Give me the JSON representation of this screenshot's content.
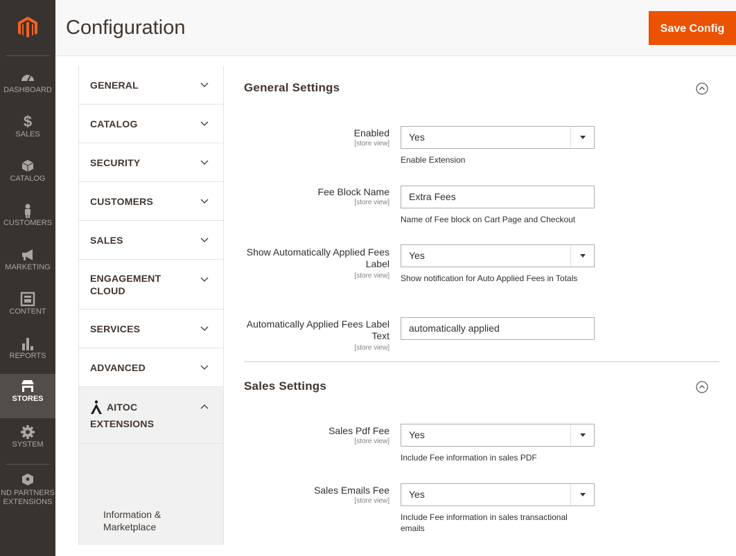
{
  "page": {
    "title": "Configuration",
    "save_label": "Save Config"
  },
  "admin_nav": [
    {
      "label": "DASHBOARD",
      "icon": "dashboard-icon"
    },
    {
      "label": "SALES",
      "icon": "dollar-icon"
    },
    {
      "label": "CATALOG",
      "icon": "cube-icon"
    },
    {
      "label": "CUSTOMERS",
      "icon": "person-icon"
    },
    {
      "label": "MARKETING",
      "icon": "megaphone-icon"
    },
    {
      "label": "CONTENT",
      "icon": "content-icon"
    },
    {
      "label": "REPORTS",
      "icon": "bar-chart-icon"
    },
    {
      "label": "STORES",
      "icon": "store-icon",
      "active": true
    },
    {
      "label": "SYSTEM",
      "icon": "gear-icon"
    },
    {
      "label": "ND PARTNERS",
      "label2": "EXTENSIONS",
      "icon": "extensions-icon"
    }
  ],
  "config_tabs": [
    {
      "label": "GENERAL"
    },
    {
      "label": "CATALOG"
    },
    {
      "label": "SECURITY"
    },
    {
      "label": "CUSTOMERS"
    },
    {
      "label": "SALES"
    },
    {
      "label": "ENGAGEMENT",
      "label2": "CLOUD"
    },
    {
      "label": "SERVICES"
    },
    {
      "label": "ADVANCED"
    },
    {
      "label": "AITOC",
      "label2": "EXTENSIONS",
      "expanded": true
    }
  ],
  "aitoc_item": "Information & Marketplace",
  "sections": {
    "general": {
      "title": "General Settings",
      "fields": [
        {
          "label": "Enabled",
          "scope": "[store view]",
          "value": "Yes",
          "note": "Enable Extension",
          "type": "select"
        },
        {
          "label": "Fee Block Name",
          "scope": "[store view]",
          "value": "Extra Fees",
          "note": "Name of Fee block on Cart Page and Checkout",
          "type": "text"
        },
        {
          "label": "Show Automatically Applied Fees Label",
          "scope": "[store view]",
          "value": "Yes",
          "note": "Show notification for Auto Applied Fees in Totals",
          "type": "select"
        },
        {
          "label": "Automatically Applied Fees Label Text",
          "scope": "[store view]",
          "value": "automatically applied",
          "note": "",
          "type": "text"
        }
      ]
    },
    "sales": {
      "title": "Sales Settings",
      "fields": [
        {
          "label": "Sales Pdf Fee",
          "scope": "[store view]",
          "value": "Yes",
          "note": "Include Fee information in sales PDF",
          "type": "select"
        },
        {
          "label": "Sales Emails Fee",
          "scope": "[store view]",
          "value": "Yes",
          "note": "Include Fee information in sales transactional emails",
          "type": "select"
        }
      ]
    }
  },
  "colors": {
    "admin_bar": "#373330",
    "accent": "#eb5202",
    "logo": "#f26322"
  }
}
